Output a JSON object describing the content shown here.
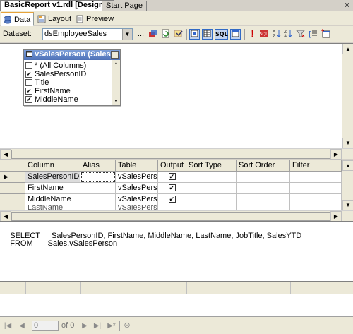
{
  "doc_tabs": [
    {
      "label": "BasicReport v1.rdl [Design]*",
      "active": true
    },
    {
      "label": "Start Page",
      "active": false
    }
  ],
  "close_glyph": "×",
  "design_tabs": [
    {
      "label": "Data",
      "icon": "data-icon",
      "active": true
    },
    {
      "label": "Layout",
      "icon": "layout-icon",
      "active": false
    },
    {
      "label": "Preview",
      "icon": "preview-icon",
      "active": false
    }
  ],
  "toolbar": {
    "dataset_label": "Dataset:",
    "dataset_value": "dsEmployeeSales",
    "ellipsis": "...",
    "sql_button": "SQL"
  },
  "table_window": {
    "title": "vSalesPerson (Sales)",
    "columns": [
      {
        "label": "* (All Columns)",
        "checked": false
      },
      {
        "label": "SalesPersonID",
        "checked": true
      },
      {
        "label": "Title",
        "checked": false
      },
      {
        "label": "FirstName",
        "checked": true
      },
      {
        "label": "MiddleName",
        "checked": true
      }
    ]
  },
  "grid": {
    "headers": [
      "Column",
      "Alias",
      "Table",
      "Output",
      "Sort Type",
      "Sort Order",
      "Filter"
    ],
    "rows": [
      {
        "column": "SalesPersonID",
        "alias": "",
        "table": "vSalesPers...",
        "output": true
      },
      {
        "column": "FirstName",
        "alias": "",
        "table": "vSalesPers...",
        "output": true
      },
      {
        "column": "MiddleName",
        "alias": "",
        "table": "vSalesPers...",
        "output": true
      },
      {
        "column": "LastName",
        "alias": "",
        "table": "vSalesPers...",
        "output": true
      }
    ]
  },
  "sql": {
    "line1_keyword": "SELECT",
    "line1_text": "SalesPersonID, FirstName, MiddleName, LastName, JobTitle, SalesYTD",
    "line2_keyword": "FROM",
    "line2_text": "Sales.vSalesPerson"
  },
  "nav": {
    "record_value": "0",
    "of_text": "of 0"
  }
}
